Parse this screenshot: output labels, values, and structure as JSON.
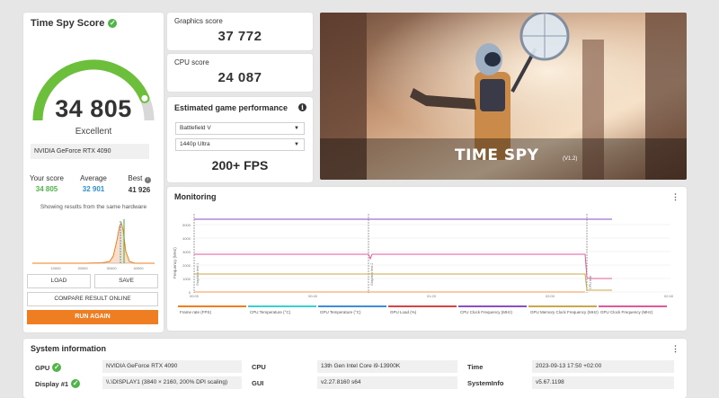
{
  "score": {
    "title": "Time Spy Score",
    "value": "34 805",
    "rating": "Excellent",
    "gpu_name": "NVIDIA GeForce RTX 4090",
    "your_score_label": "Your score",
    "your_score": "34 805",
    "average_label": "Average",
    "average": "32 901",
    "best_label": "Best",
    "best": "41 926",
    "note": "Showing results from the same hardware",
    "gauge_fill_fraction": 0.87,
    "colors": {
      "gauge": "#6bbf3a",
      "your": "#4fb548",
      "average": "#2f8fd6",
      "accent": "#ef7d22"
    }
  },
  "distribution": {
    "x_ticks": [
      "10000",
      "20000",
      "30000",
      "40000"
    ]
  },
  "buttons": {
    "load": "LOAD",
    "save": "SAVE",
    "compare": "COMPARE RESULT ONLINE",
    "run_again": "RUN AGAIN"
  },
  "graphics": {
    "label": "Graphics score",
    "value": "37 772"
  },
  "cpu": {
    "label": "CPU score",
    "value": "24 087"
  },
  "estimate": {
    "title": "Estimated game performance",
    "game": "Battlefield V",
    "quality": "1440p Ultra",
    "fps": "200+ FPS"
  },
  "hero": {
    "title": "TIME SPY",
    "version": "(V1.2)"
  },
  "monitoring": {
    "title": "Monitoring",
    "y_axis_label": "Frequency (MHz)",
    "y_ticks": [
      "5000",
      "4000",
      "3000",
      "2000",
      "1000",
      "0"
    ],
    "x_ticks": [
      "00:00",
      "00:40",
      "01:20",
      "02:00",
      "02:40"
    ],
    "markers": [
      "Graphics test 1",
      "Graphics test 2",
      "CPU test"
    ],
    "legend": [
      {
        "label": "Frame rate (FPS)",
        "color": "#ef7d22"
      },
      {
        "label": "CPU Temperature (°C)",
        "color": "#3ccfcf"
      },
      {
        "label": "GPU Temperature (°C)",
        "color": "#3a8fd6"
      },
      {
        "label": "GPU Load (%)",
        "color": "#d64545"
      },
      {
        "label": "CPU Clock Frequency (MHz)",
        "color": "#8a4fc4"
      },
      {
        "label": "GPU Memory Clock Frequency (MHz)",
        "color": "#c8a84a"
      },
      {
        "label": "GPU Clock Frequency (MHz)",
        "color": "#e05a9a"
      }
    ]
  },
  "system": {
    "title": "System information",
    "gpu_label": "GPU",
    "gpu_value": "NVIDIA GeForce RTX 4090",
    "display_label": "Display #1",
    "display_value": "\\\\.\\DISPLAY1 (3840 × 2160, 200% DPI scaling)",
    "cpu_label": "CPU",
    "cpu_value": "13th Gen Intel Core i9-13900K",
    "gui_label": "GUI",
    "gui_value": "v2.27.8160 s64",
    "time_label": "Time",
    "time_value": "2023-09-13 17:50 +02:00",
    "sysinfo_label": "SystemInfo",
    "sysinfo_value": "v5.67.1198"
  }
}
